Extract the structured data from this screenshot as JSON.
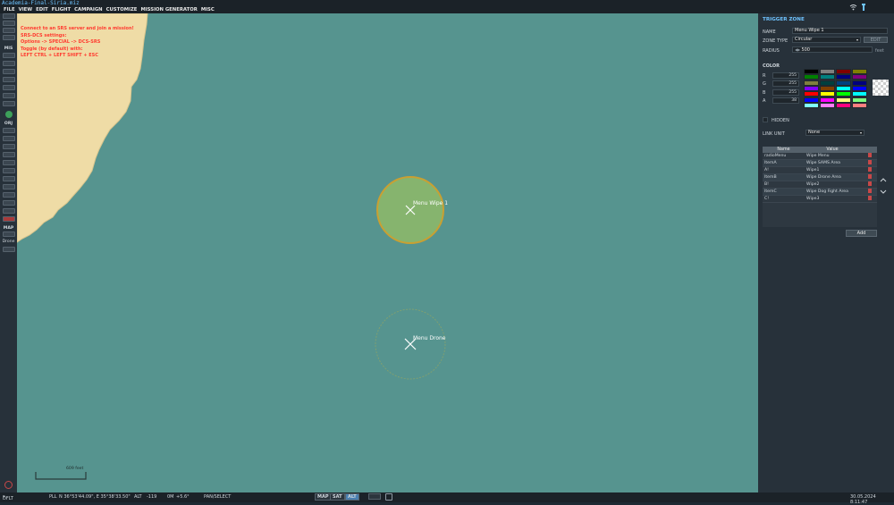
{
  "window": {
    "title": "Academia-Final-Siria.miz"
  },
  "menu": [
    "FILE",
    "VIEW",
    "EDIT",
    "FLIGHT",
    "CAMPAIGN",
    "CUSTOMIZE",
    "MISSION GENERATOR",
    "MISC"
  ],
  "map_message": "Connect to an SRS server and join a mission!\nSRS-DCS settings:\nOptions -> SPECIAL -> DCS-SRS\nToggle (by default) with:\nLEFT CTRL + LEFT SHIFT + ESC",
  "left_toolbar": {
    "mis_label": "MIS",
    "orj_label": "ORJ",
    "map_label": "MAP",
    "drone_label": "Drone"
  },
  "map": {
    "zones": [
      {
        "name": "Menu Wipe 1",
        "selected": true
      },
      {
        "name": "Menu Drone",
        "selected": false
      }
    ],
    "scale_label": "609 feet"
  },
  "panel": {
    "title": "TRIGGER ZONE",
    "name_label": "NAME",
    "name_value": "Menu Wipe 1",
    "zone_type_label": "ZONE TYPE",
    "zone_type_value": "Circular",
    "edit_label": "EDIT",
    "radius_label": "RADIUS",
    "radius_value": "500",
    "radius_unit": "feet",
    "color_label": "COLOR",
    "color_channels": [
      {
        "label": "R",
        "value": "255"
      },
      {
        "label": "G",
        "value": "255"
      },
      {
        "label": "B",
        "value": "255"
      },
      {
        "label": "A",
        "value": "38"
      }
    ],
    "palette": [
      "#000000",
      "#7f7f7f",
      "#7f0000",
      "#7f7f00",
      "#007f00",
      "#007f7f",
      "#00007f",
      "#7f007f",
      "#7f7f3f",
      "#003f3f",
      "#003f7f",
      "#00007f",
      "#7f00ff",
      "#7f3f00",
      "#00ffff",
      "#0000ff",
      "#ff0000",
      "#ffff00",
      "#00ff00",
      "#00ffff",
      "#0000ff",
      "#ff00ff",
      "#ffff7f",
      "#7fff7f",
      "#7fffff",
      "#ff7fff",
      "#ff007f",
      "#ff7f7f"
    ],
    "hidden_label": "HIDDEN",
    "link_unit_label": "LINK UNIT",
    "link_unit_value": "None",
    "table_headers": [
      "Name",
      "Value"
    ],
    "properties": [
      {
        "name": "radioMenu",
        "value": "Wipe Menu"
      },
      {
        "name": "ItemA",
        "value": "Wipe SAMS Area"
      },
      {
        "name": "A!",
        "value": "Wipe1"
      },
      {
        "name": "ItemB",
        "value": "Wipe Drone Area"
      },
      {
        "name": "B!",
        "value": "Wipe2"
      },
      {
        "name": "ItemC",
        "value": "Wipe Dog Fight Area"
      },
      {
        "name": "C!",
        "value": "Wipe3"
      }
    ],
    "add_label": "Add"
  },
  "status": {
    "mode": "DFLT",
    "coord_label": "PLL",
    "coord_value": "N 36°53'44.09\", E 35°38'33.50\"",
    "alt_label": "ALT",
    "alt_value": "-119",
    "wind_label": "0M",
    "wind_value": "+5.6°",
    "action": "PAN/SELECT",
    "map_btn": "MAP",
    "sat_btn": "SAT",
    "alt_btn": "ALT",
    "datetime": "30.05.2024 8:11:47"
  },
  "colors": {
    "sea": "#56948f",
    "land": "#efdca6",
    "zone_fill": "#86b46e",
    "zone_border": "#c9a032",
    "accent": "#6ec3ff"
  }
}
